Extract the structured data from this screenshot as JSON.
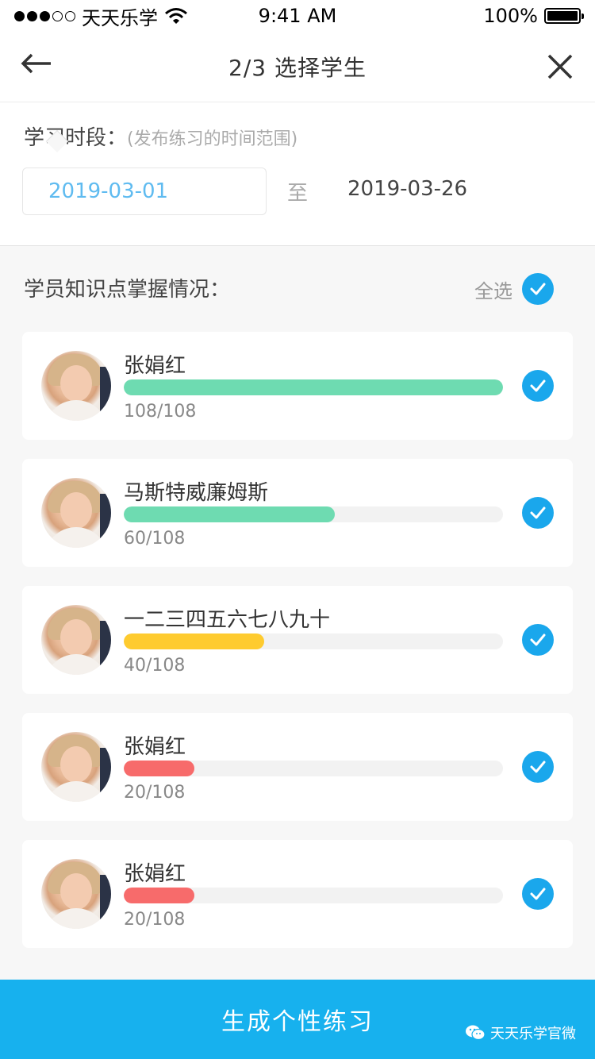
{
  "status_bar": {
    "carrier": "天天乐学",
    "time": "9:41 AM",
    "battery": "100%"
  },
  "nav": {
    "title": "2/3 选择学生"
  },
  "period": {
    "label": "学习时段：",
    "hint": "(发布练习的时间范围)",
    "start_date": "2019-03-01",
    "to_label": "至",
    "end_date": "2019-03-26"
  },
  "students_section": {
    "label": "学员知识点掌握情况：",
    "select_all": "全选"
  },
  "students": [
    {
      "name": "张娟红",
      "mastered": 108,
      "total": 108,
      "progress_text": "108/108",
      "bar_color": "#6edbb1"
    },
    {
      "name": "马斯特威廉姆斯",
      "mastered": 60,
      "total": 108,
      "progress_text": "60/108",
      "bar_color": "#6edbb1"
    },
    {
      "name": "一二三四五六七八九十",
      "mastered": 40,
      "total": 108,
      "progress_text": "40/108",
      "bar_color": "#fecb2f"
    },
    {
      "name": "张娟红",
      "mastered": 20,
      "total": 108,
      "progress_text": "20/108",
      "bar_color": "#f76b6b"
    },
    {
      "name": "张娟红",
      "mastered": 20,
      "total": 108,
      "progress_text": "20/108",
      "bar_color": "#f76b6b"
    }
  ],
  "footer": {
    "generate_label": "生成个性练习",
    "watermark": "天天乐学官微"
  },
  "icons": {
    "back": "arrow-left-icon",
    "close": "close-icon",
    "check": "check-circle-icon",
    "wifi": "wifi-icon",
    "battery": "battery-icon",
    "wechat": "wechat-icon"
  },
  "colors": {
    "accent": "#1aa7ec",
    "button": "#17b1ee",
    "date_active": "#5fbbf0"
  }
}
